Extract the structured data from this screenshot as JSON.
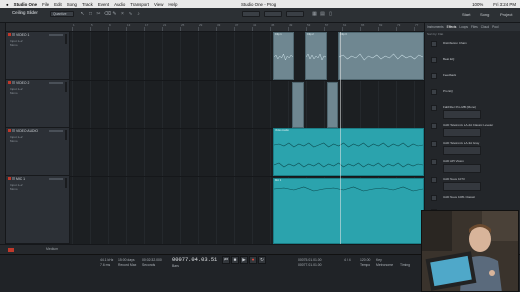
{
  "menubar": {
    "apple": "",
    "app": "Studio One",
    "items": [
      "File",
      "Edit",
      "Song",
      "Track",
      "Event",
      "Audio",
      "Transport",
      "View",
      "Help"
    ],
    "window_title": "Studio One - Prog",
    "clock": "Fri 3:24 PM",
    "status": "100%"
  },
  "toolbar": {
    "song": "Ceiling Slider",
    "snap_label": "Quantize",
    "start": "Start",
    "song_label": "Song",
    "project": "Project"
  },
  "tracks": [
    {
      "name": "VIDEO 1"
    },
    {
      "name": "VIDEO 2"
    },
    {
      "name": "VIDEO AUDIO"
    },
    {
      "name": "MIC 1"
    }
  ],
  "track_sub": {
    "input": "Input 1+2",
    "mode": "Mono"
  },
  "ruler": {
    "numbers": [
      "1",
      "5",
      "9",
      "13",
      "17",
      "21",
      "25",
      "29",
      "33",
      "37",
      "41",
      "45",
      "49",
      "53",
      "57",
      "61",
      "65",
      "69",
      "73",
      "77"
    ]
  },
  "clips": [
    {
      "label": "Clip 1"
    },
    {
      "label": "Clip 2"
    },
    {
      "label": "Clip 3"
    },
    {
      "label": "Video Audio"
    },
    {
      "label": "Mic 1"
    }
  ],
  "bottombar": {
    "label": "Medium"
  },
  "transport": {
    "sample_rate": "44.1 kHz",
    "latency": "7.6 ms",
    "record_max": "15:00 days",
    "record_label": "Record Max",
    "time": "00:02:32.000",
    "time_label": "Seconds",
    "position": "00077.04.03.51",
    "position_label": "Bars",
    "loop_start": "00075.01.01.00",
    "loop_end": "00077.01.01.00",
    "sig": "4 / 4",
    "tempo": "120.00",
    "tempo_label": "Tempo",
    "metronome": "Metronome",
    "key": "Key",
    "timing": "Timing"
  },
  "browser": {
    "tabs": [
      "Instruments",
      "Effects",
      "Loops",
      "Files",
      "Cloud",
      "Pool"
    ],
    "active_tab": "Effects",
    "header": "Sort by: Flat",
    "items": [
      "Distribution Chain",
      "Beat EQ",
      "Feedback",
      "Pro EQ",
      "FabFilter Pro-MB (Mono)",
      "UAD Teletronix LA-2A Classic Leveler",
      "UAD Teletronix LA-3A Gray",
      "UAD API Vision",
      "UAD Neve 1073",
      "UAD Neve 1081 Classic",
      "UAD Neve 88RS"
    ]
  },
  "colors": {
    "teal": "#2ba3ad",
    "grey_clip": "#6f8791",
    "record": "#c0392b"
  }
}
